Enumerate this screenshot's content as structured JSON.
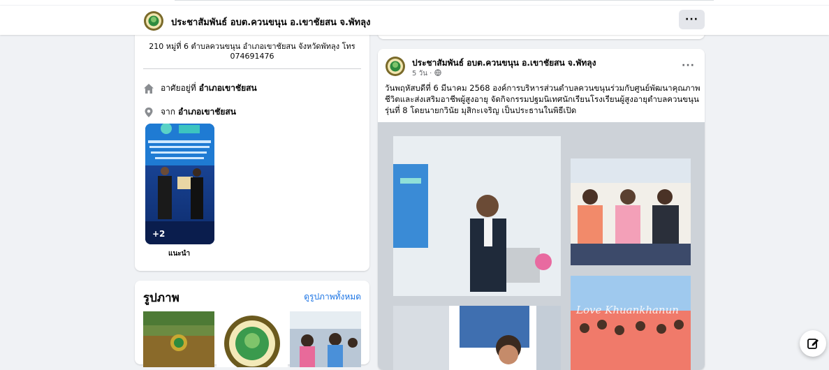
{
  "header": {
    "page_name": "ประชาสัมพันธ์ อบต.ควนขนุน อ.เขาชัยสน จ.พัทลุง",
    "more_label": "···"
  },
  "intro": {
    "address": "210 หมู่ที่ 6 ตำบลควนขนุน อำเภอเขาชัยสน จังหวัดพัทลุง โทร 074691476",
    "lives_in_label": "อาศัยอยู่ที่",
    "lives_in_value": "อำเภอเขาชัยสน",
    "from_label": "จาก",
    "from_value": "อำเภอเขาชัยสน",
    "featured_count": "+2",
    "featured_label": "แนะนำ"
  },
  "photos": {
    "heading": "รูปภาพ",
    "see_all": "ดูรูปภาพทั้งหมด"
  },
  "post": {
    "author": "ประชาสัมพันธ์ อบต.ควนขนุน อ.เขาชัยสน จ.พัทลุง",
    "time": "5 วัน ·",
    "more_label": "···",
    "text": "วันพฤหัสบดีที่ 6 มีนาคม 2568 องค์การบริหารส่วนตำบลควนขนุนร่วมกับศูนย์พัฒนาคุณภาพชีวิตและส่งเสริมอาชีพผู้สูงอายุ จัดกิจกรรมปฐมนิเทศนักเรียนโรงเรียนผู้สูงอายุตำบลควนขนุน รุ่นที่ 8 โดยนายกวินัย มุสิกะเจริญ เป็นประธานในพิธีเปิด",
    "photo_overlay_text": "Love Khuankhanun"
  },
  "colors": {
    "accent": "#1b74e4",
    "banner_pink": "#f08a9c"
  },
  "icons": [
    "home-icon",
    "location-pin-icon",
    "globe-icon",
    "compose-icon",
    "more-icon"
  ]
}
